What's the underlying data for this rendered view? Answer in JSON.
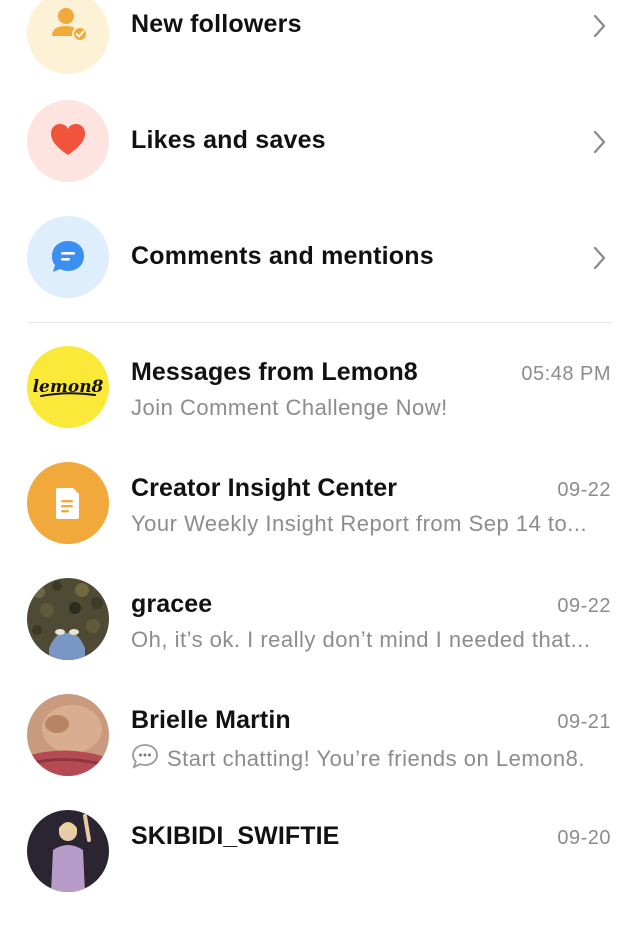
{
  "notifications": [
    {
      "title": "New followers",
      "icon": "person-check-icon",
      "bg": "#fdf1d6",
      "accent": "#f2a93b"
    },
    {
      "title": "Likes and saves",
      "icon": "heart-icon",
      "bg": "#fde4e1",
      "accent": "#f0553c"
    },
    {
      "title": "Comments and mentions",
      "icon": "comment-icon",
      "bg": "#dfeefd",
      "accent": "#3b8ff0"
    }
  ],
  "chats": [
    {
      "name": "Messages from Lemon8",
      "time": "05:48 PM",
      "preview": "Join Comment Challenge Now!",
      "avatar_text": "lemon8",
      "avatar_color": "#fbe93a"
    },
    {
      "name": "Creator Insight Center",
      "time": "09-22",
      "preview": "Your Weekly Insight Report from Sep 14 to...",
      "avatar_color": "#f2a93b"
    },
    {
      "name": "gracee",
      "time": "09-22",
      "preview": "Oh, it’s ok. I really don’t mind I needed that..."
    },
    {
      "name": "Brielle Martin",
      "time": "09-21",
      "preview": "Start chatting! You’re friends on Lemon8."
    },
    {
      "name": "SKIBIDI_SWIFTIE",
      "time": "09-20",
      "preview": ""
    }
  ]
}
